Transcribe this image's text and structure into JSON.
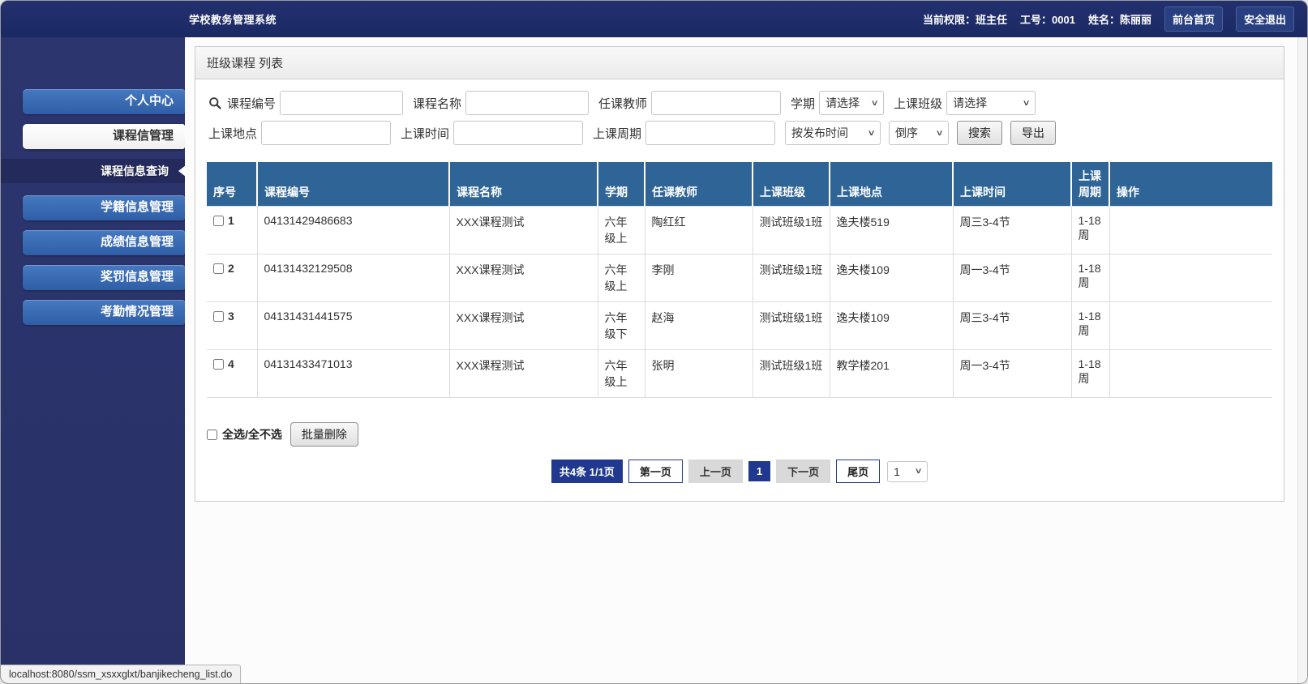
{
  "colors": {
    "header_bg": "#1c2a66",
    "topbar_button_bg": "#283f80",
    "sidebar_bg": "#2b3370",
    "nav_button_top": "#4679bf",
    "nav_button_bottom": "#2f5ea7",
    "table_header_bg": "#2e6496",
    "pagination_navy": "#20398e"
  },
  "icons": {
    "select_chevron": "∨"
  },
  "header": {
    "title": "学校教务管理系统",
    "permission": "当前权限：班主任",
    "work_id": "工号：0001",
    "name": "姓名：陈丽丽",
    "home_button": "前台首页",
    "logout_button": "安全退出"
  },
  "sidebar": {
    "items": [
      {
        "label": "个人中心"
      },
      {
        "label": "课程信管理"
      },
      {
        "label": "学籍信息管理"
      },
      {
        "label": "成绩信息管理"
      },
      {
        "label": "奖罚信息管理"
      },
      {
        "label": "考勤情况管理"
      }
    ],
    "submenu_item": "课程信息查询"
  },
  "page": {
    "title": "班级课程 列表"
  },
  "search": {
    "row1": {
      "course_code_label": "课程编号",
      "course_name_label": "课程名称",
      "teacher_label": "任课教师",
      "semester_label": "学期",
      "semester_value": "请选择",
      "class_label": "上课班级",
      "class_value": "请选择"
    },
    "row2": {
      "location_label": "上课地点",
      "time_label": "上课时间",
      "period_label": "上课周期",
      "sort_field_value": "按发布时间",
      "sort_order_value": "倒序",
      "search_button": "搜索",
      "export_button": "导出"
    }
  },
  "table": {
    "headers": [
      "序号",
      "课程编号",
      "课程名称",
      "学期",
      "任课教师",
      "上课班级",
      "上课地点",
      "上课时间",
      "上课周期",
      "操作"
    ],
    "rows": [
      {
        "num": "1",
        "code": "04131429486683",
        "name": "XXX课程测试",
        "semester": "六年级上",
        "teacher": "陶红红",
        "clazz": "测试班级1班",
        "location": "逸夫楼519",
        "time": "周三3-4节",
        "period": "1-18周"
      },
      {
        "num": "2",
        "code": "04131432129508",
        "name": "XXX课程测试",
        "semester": "六年级上",
        "teacher": "李刚",
        "clazz": "测试班级1班",
        "location": "逸夫楼109",
        "time": "周一3-4节",
        "period": "1-18周"
      },
      {
        "num": "3",
        "code": "04131431441575",
        "name": "XXX课程测试",
        "semester": "六年级下",
        "teacher": "赵海",
        "clazz": "测试班级1班",
        "location": "逸夫楼109",
        "time": "周三3-4节",
        "period": "1-18周"
      },
      {
        "num": "4",
        "code": "04131433471013",
        "name": "XXX课程测试",
        "semester": "六年级上",
        "teacher": "张明",
        "clazz": "测试班级1班",
        "location": "教学楼201",
        "time": "周一3-4节",
        "period": "1-18周"
      }
    ]
  },
  "footer": {
    "select_all_label": "全选/全不选",
    "batch_delete_button": "批量删除"
  },
  "pagination": {
    "total": "共4条 1/1页",
    "first": "第一页",
    "prev": "上一页",
    "current": "1",
    "next": "下一页",
    "last": "尾页",
    "page_select_value": "1"
  },
  "window": {
    "status_url": "localhost:8080/ssm_xsxxglxt/banjikecheng_list.do"
  }
}
